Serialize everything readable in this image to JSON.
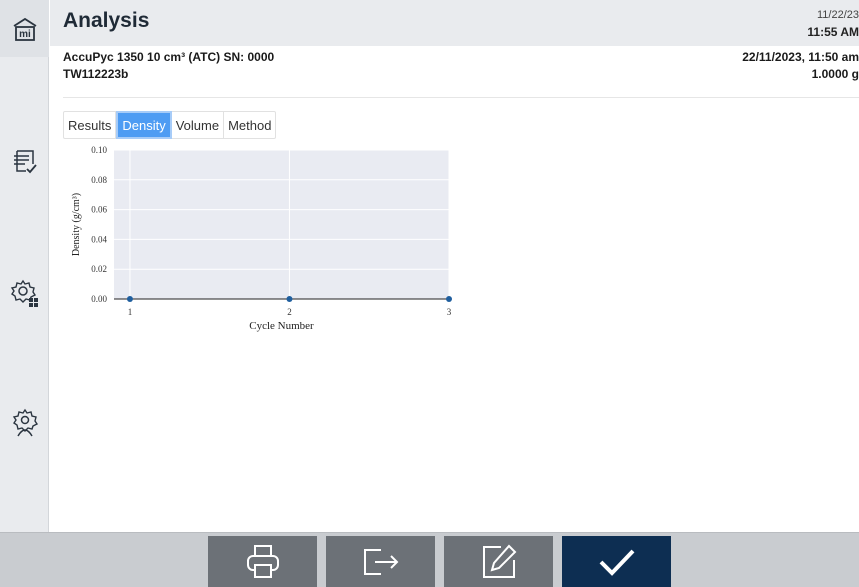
{
  "header": {
    "title": "Analysis",
    "date": "11/22/23",
    "time": "11:55 AM"
  },
  "info": {
    "instrument": "AccuPyc 1350 10 cm³ (ATC) SN: 0000",
    "sample_id": "TW112223b",
    "analysis_datetime": "22/11/2023, 11:50 am",
    "mass": "1.0000 g"
  },
  "tabs": [
    {
      "label": "Results",
      "active": false
    },
    {
      "label": "Density",
      "active": true
    },
    {
      "label": "Volume",
      "active": false
    },
    {
      "label": "Method",
      "active": false
    }
  ],
  "sidebar": {
    "items": [
      {
        "icon": "home-icon"
      },
      {
        "icon": "report-checklist-icon"
      },
      {
        "icon": "settings-grid-icon"
      },
      {
        "icon": "user-settings-icon"
      }
    ]
  },
  "chart_data": {
    "type": "scatter",
    "xlabel": "Cycle Number",
    "ylabel": "Density (g/cm³)",
    "x": [
      1,
      2,
      3
    ],
    "y": [
      0,
      0,
      0
    ],
    "xticks": [
      "1",
      "2",
      "3"
    ],
    "yticks": [
      "0.00",
      "0.02",
      "0.04",
      "0.06",
      "0.08",
      "0.10"
    ],
    "ylim": [
      0,
      0.1
    ],
    "xlim": [
      0.9,
      3.0
    ],
    "grid": true,
    "point_color": "#1f5e9e",
    "plot_background": "#e9ebf2"
  },
  "footer": {
    "buttons": [
      {
        "icon": "printer-icon"
      },
      {
        "icon": "export-icon"
      },
      {
        "icon": "edit-icon"
      },
      {
        "icon": "checkmark-icon"
      }
    ]
  },
  "colors": {
    "accent": "#4e9cf3",
    "primary_button": "#0d2e52",
    "secondary_button": "#6c7177"
  }
}
